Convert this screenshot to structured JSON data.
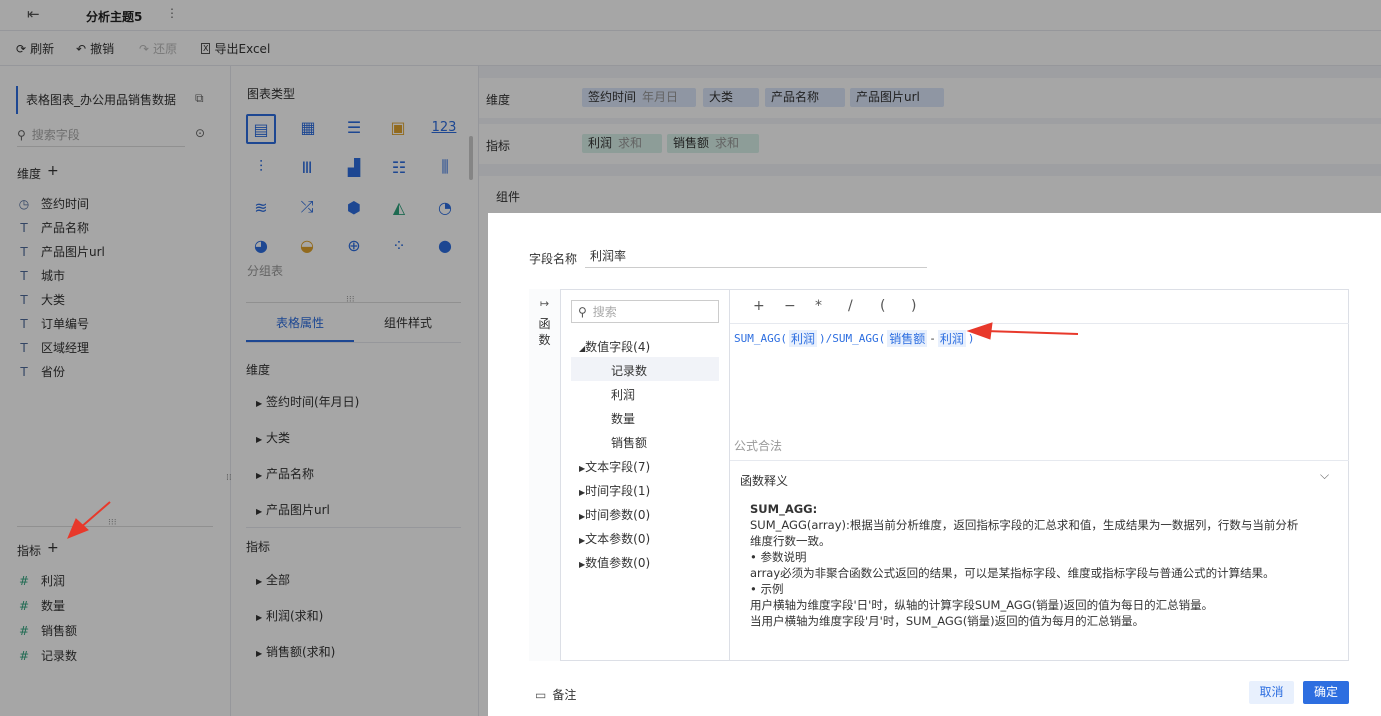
{
  "topbar": {
    "back_icon": "exit-icon",
    "title": "分析主题5",
    "more_icon": "more-vertical-icon"
  },
  "toolbar": {
    "refresh": "刷新",
    "undo": "撤销",
    "redo": "还原",
    "export": "导出Excel"
  },
  "left": {
    "dataset": "表格图表_办公用品销售数据",
    "search_placeholder": "搜索字段",
    "dim_title": "维度",
    "dimensions": [
      {
        "icon": "clock-icon",
        "label": "签约时间"
      },
      {
        "icon": "text-type-icon",
        "label": "产品名称"
      },
      {
        "icon": "text-type-icon",
        "label": "产品图片url"
      },
      {
        "icon": "text-type-icon",
        "label": "城市"
      },
      {
        "icon": "text-type-icon",
        "label": "大类"
      },
      {
        "icon": "text-type-icon",
        "label": "订单编号"
      },
      {
        "icon": "text-type-icon",
        "label": "区域经理"
      },
      {
        "icon": "text-type-icon",
        "label": "省份"
      }
    ],
    "metric_title": "指标",
    "metrics": [
      "利润",
      "数量",
      "销售额",
      "记录数"
    ]
  },
  "mid": {
    "chart_type_title": "图表类型",
    "group_table": "分组表",
    "tabs": [
      "表格属性",
      "组件样式"
    ],
    "dim_title": "维度",
    "dim_items": [
      "签约时间(年月日)",
      "大类",
      "产品名称",
      "产品图片url"
    ],
    "metric_title": "指标",
    "metric_items": [
      "全部",
      "利润(求和)",
      "销售额(求和)"
    ]
  },
  "right": {
    "dim_label": "维度",
    "dim_pills": [
      {
        "label": "签约时间",
        "sub": "年月日"
      },
      {
        "label": "大类",
        "sub": ""
      },
      {
        "label": "产品名称",
        "sub": ""
      },
      {
        "label": "产品图片url",
        "sub": ""
      }
    ],
    "metric_label": "指标",
    "metric_pills": [
      {
        "label": "利润",
        "sub": "求和"
      },
      {
        "label": "销售额",
        "sub": "求和"
      }
    ],
    "component_label": "组件"
  },
  "dialog": {
    "field_name_label": "字段名称",
    "field_name_value": "利润率",
    "side_tab": "函数",
    "search_placeholder": "搜索",
    "tree": {
      "numeric": "数值字段(4)",
      "numeric_items": [
        "记录数",
        "利润",
        "数量",
        "销售额"
      ],
      "others": [
        "文本字段(7)",
        "时间字段(1)",
        "时间参数(0)",
        "文本参数(0)",
        "数值参数(0)"
      ]
    },
    "operators": [
      "+",
      "−",
      "*",
      "/",
      "(",
      ")"
    ],
    "formula": {
      "fn1": "SUM_AGG(",
      "f1": "利润",
      "mid": ")/SUM_AGG(",
      "f2": "销售额",
      "minus": "-",
      "f3": "利润",
      "end": ")"
    },
    "valid": "公式合法",
    "desc_title": "函数释义",
    "desc": {
      "name": "SUM_AGG:",
      "line1": "SUM_AGG(array):根据当前分析维度，返回指标字段的汇总求和值，生成结果为一数据列，行数与当前分析",
      "line2": "维度行数一致。",
      "line3": "• 参数说明",
      "line4": "array必须为非聚合函数公式返回的结果，可以是某指标字段、维度或指标字段与普通公式的计算结果。",
      "line5": "• 示例",
      "line6": "用户横轴为维度字段'日'时，纵轴的计算字段SUM_AGG(销量)返回的值为每日的汇总销量。",
      "line7": "当用户横轴为维度字段'月'时，SUM_AGG(销量)返回的值为每月的汇总销量。"
    },
    "remark": "备注",
    "cancel": "取消",
    "ok": "确定"
  },
  "colors": {
    "accent": "#2d6ee0",
    "arrow": "#e8392b",
    "pill_dim": "#dce7fb",
    "pill_metric": "#d9f2ea"
  }
}
